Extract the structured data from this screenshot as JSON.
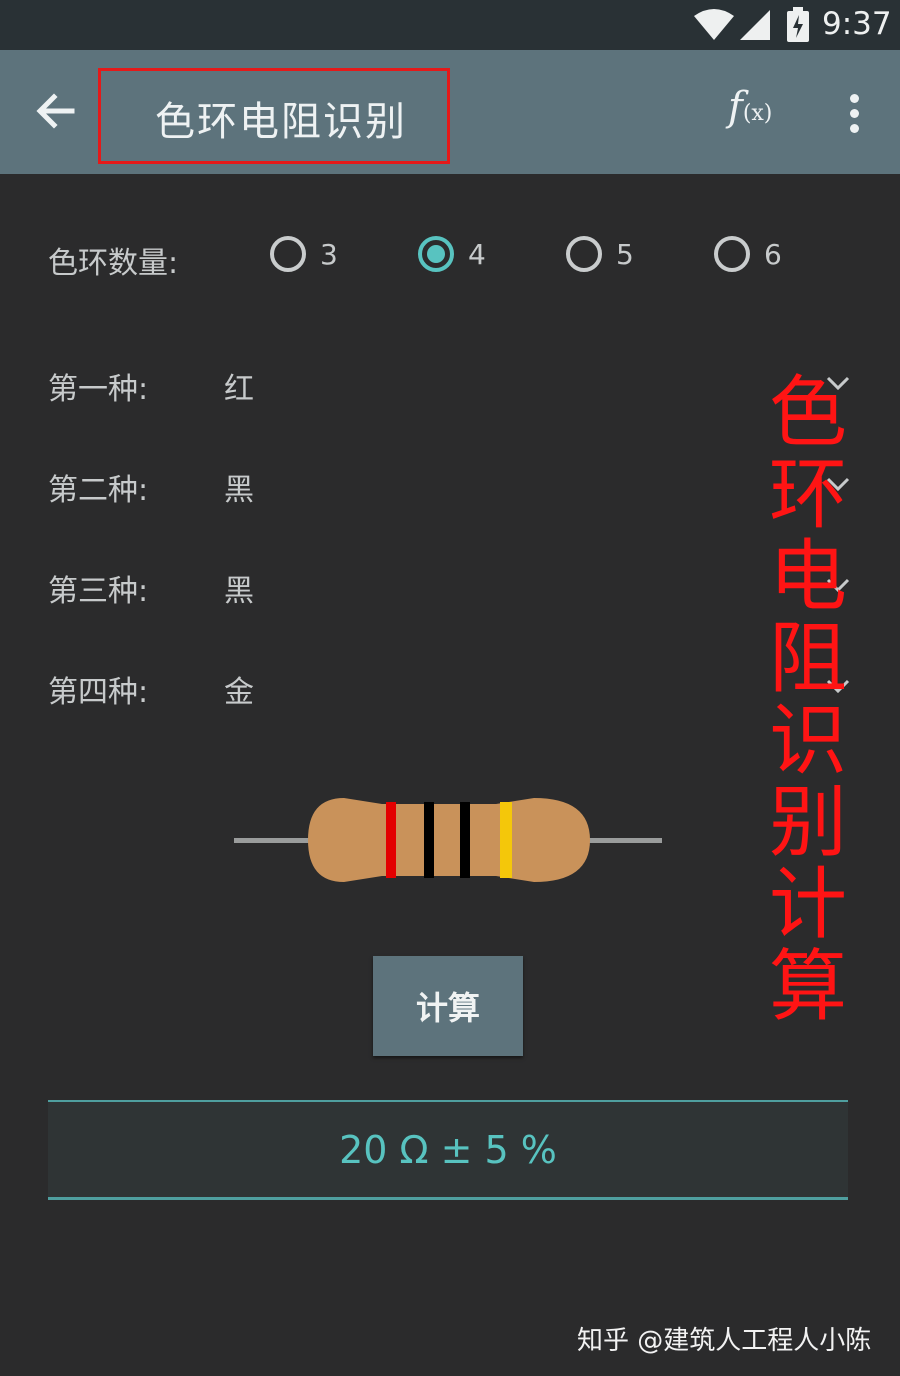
{
  "status_bar": {
    "time": "9:37",
    "wifi_icon": "wifi-icon",
    "signal_icon": "signal-icon",
    "battery_icon": "battery-icon"
  },
  "app_bar": {
    "title": "色环电阻识别",
    "fx_label": "f",
    "fx_sub": "(x)",
    "back_icon": "arrow-left-icon",
    "menu_icon": "more-vert-icon",
    "highlight_color": "#e51919"
  },
  "ring_count": {
    "label": "色环数量:",
    "options": [
      "3",
      "4",
      "5",
      "6"
    ],
    "selected": "4"
  },
  "bands": [
    {
      "label": "第一种:",
      "value": "红"
    },
    {
      "label": "第二种:",
      "value": "黑"
    },
    {
      "label": "第三种:",
      "value": "黑"
    },
    {
      "label": "第四种:",
      "value": "金"
    }
  ],
  "resistor_colors": {
    "body": "#c9925a",
    "band1": "#e30000",
    "band2": "#000000",
    "band3": "#000000",
    "band4": "#f4c70a"
  },
  "overlay_caption": [
    "色",
    "环",
    "电",
    "阻",
    "识",
    "别",
    "计",
    "算"
  ],
  "calc_button": "计算",
  "result": "20 Ω ± 5 %",
  "watermark": "知乎 @建筑人工程人小陈",
  "colors": {
    "accent": "#58c3c0",
    "app_bar": "#5d737c",
    "background": "#2b2b2c",
    "overlay": "#ff1414"
  }
}
